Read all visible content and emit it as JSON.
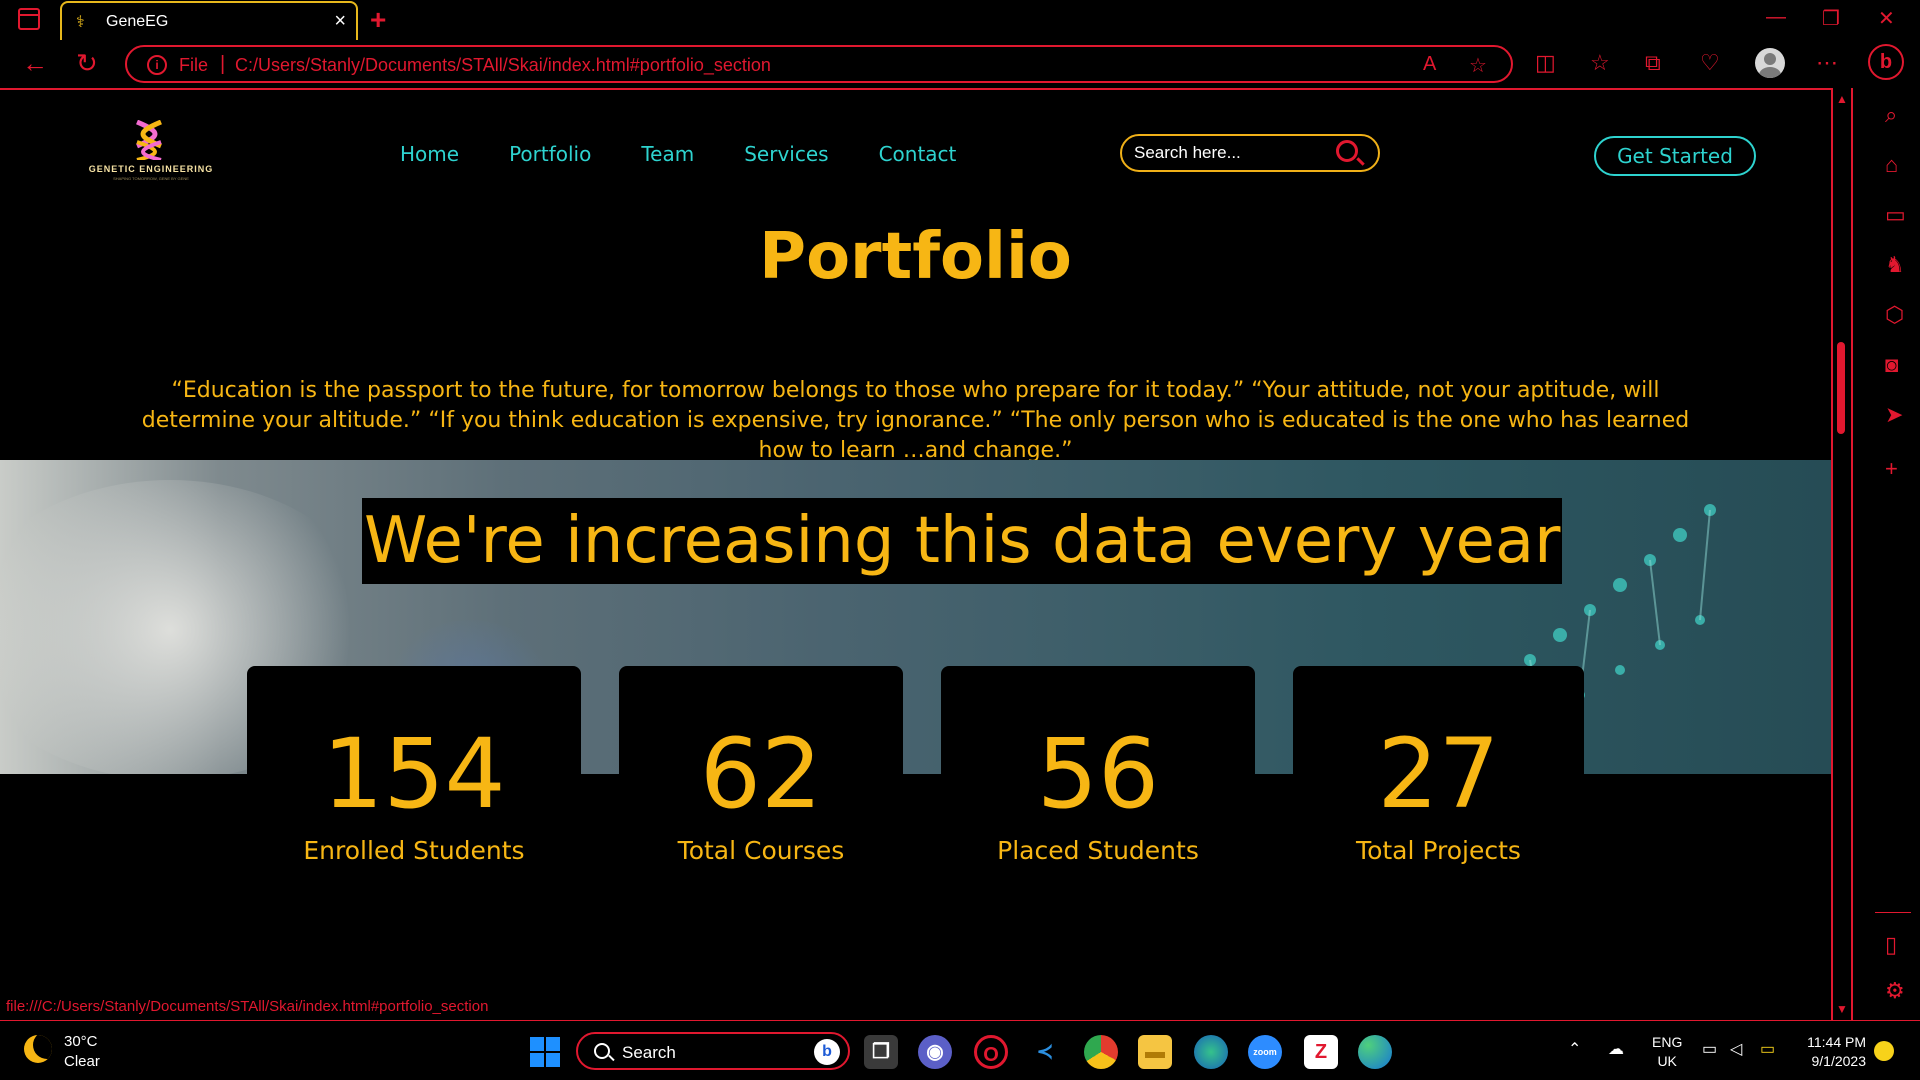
{
  "browser": {
    "tab_title": "GeneEG",
    "address_prefix": "File",
    "address_url": "C:/Users/Stanly/Documents/STAll/Skai/index.html#portfolio_section",
    "status_url": "file:///C:/Users/Stanly/Documents/STAll/Skai/index.html#portfolio_section"
  },
  "site": {
    "logo_text": "GENETIC ENGINEERING",
    "logo_tagline": "SHAPING TOMORROW, GENE BY GENE",
    "nav": [
      "Home",
      "Portfolio",
      "Team",
      "Services",
      "Contact"
    ],
    "search_placeholder": "Search here...",
    "cta_label": "Get Started"
  },
  "portfolio": {
    "title": "Portfolio",
    "quote": "“Education is the passport to the future, for tomorrow belongs to those who prepare for it today.” “Your attitude, not your aptitude, will determine your altitude.” “If you think education is expensive, try ignorance.” “The only person who is educated is the one who has learned how to learn …and change.”",
    "banner_heading": "We're increasing this data every year",
    "stats": [
      {
        "value": "154",
        "label": "Enrolled Students"
      },
      {
        "value": "62",
        "label": "Total Courses"
      },
      {
        "value": "56",
        "label": "Placed Students"
      },
      {
        "value": "27",
        "label": "Total Projects"
      }
    ]
  },
  "taskbar": {
    "weather_temp": "30°C",
    "weather_cond": "Clear",
    "search_label": "Search",
    "lang_1": "ENG",
    "lang_2": "UK",
    "time": "11:44 PM",
    "date": "9/1/2023"
  },
  "colors": {
    "accent": "#e1182f",
    "brand_yellow": "#f7b614",
    "nav_teal": "#2ed3cf"
  }
}
